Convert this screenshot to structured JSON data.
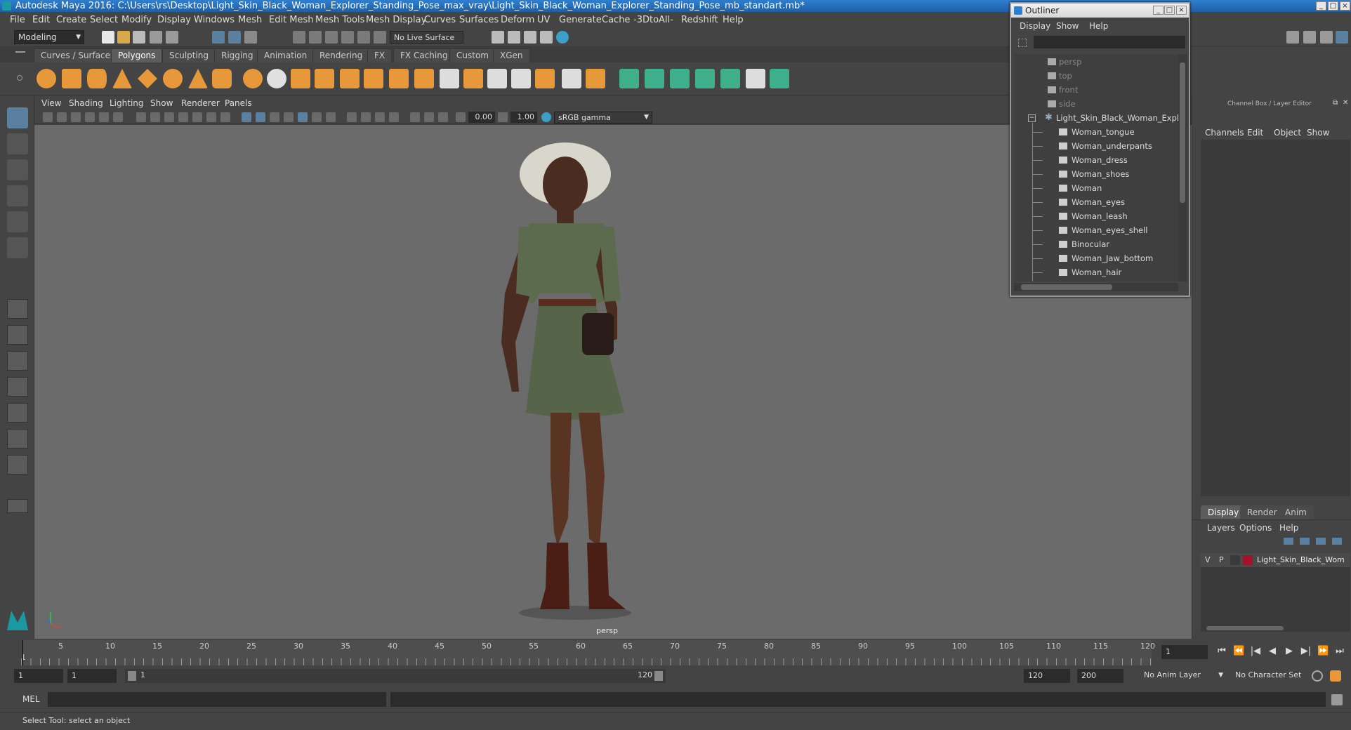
{
  "window": {
    "title": "Autodesk Maya 2016: C:\\Users\\rs\\Desktop\\Light_Skin_Black_Woman_Explorer_Standing_Pose_max_vray\\Light_Skin_Black_Woman_Explorer_Standing_Pose_mb_standart.mb*"
  },
  "menu": [
    "File",
    "Edit",
    "Create",
    "Select",
    "Modify",
    "Display",
    "Windows",
    "Mesh",
    "Edit Mesh",
    "Mesh Tools",
    "Mesh Display",
    "Curves",
    "Surfaces",
    "Deform",
    "UV",
    "Generate",
    "Cache",
    "-3DtoAll-",
    "Redshift",
    "Help"
  ],
  "status": {
    "mode": "Modeling",
    "live_surface": "No Live Surface"
  },
  "shelf_tabs": [
    "Curves / Surfaces",
    "Polygons",
    "Sculpting",
    "Rigging",
    "Animation",
    "Rendering",
    "FX",
    "FX Caching",
    "Custom",
    "XGen"
  ],
  "shelf_active": "Polygons",
  "panel_menu": [
    "View",
    "Shading",
    "Lighting",
    "Show",
    "Renderer",
    "Panels"
  ],
  "panel_tools": {
    "exposure": "0.00",
    "gamma": "1.00",
    "color_space": "sRGB gamma"
  },
  "viewport": {
    "camera_label": "persp"
  },
  "outliner": {
    "title": "Outliner",
    "menu": [
      "Display",
      "Show",
      "Help"
    ],
    "cameras": [
      "persp",
      "top",
      "front",
      "side"
    ],
    "group": "Light_Skin_Black_Woman_Explorer",
    "children": [
      "Woman_tongue",
      "Woman_underpants",
      "Woman_dress",
      "Woman_shoes",
      "Woman",
      "Woman_eyes",
      "Woman_leash",
      "Woman_eyes_shell",
      "Binocular",
      "Woman_Jaw_bottom",
      "Woman_hair"
    ]
  },
  "channel_box": {
    "title": "Channel Box / Layer Editor",
    "menu": [
      "Channels",
      "Edit",
      "Object",
      "Show"
    ],
    "tabs": [
      "Display",
      "Render",
      "Anim"
    ],
    "layer_menu": [
      "Layers",
      "Options",
      "Help"
    ],
    "layer": {
      "v": "V",
      "p": "P",
      "name": "Light_Skin_Black_Wom",
      "color": "#a0142a"
    }
  },
  "timeline": {
    "ticks": [
      "5",
      "10",
      "15",
      "20",
      "25",
      "30",
      "35",
      "40",
      "45",
      "50",
      "55",
      "60",
      "65",
      "70",
      "75",
      "80",
      "85",
      "90",
      "95",
      "100",
      "105",
      "110",
      "115",
      "120"
    ],
    "current_frame_label": "1",
    "current_frame": "1"
  },
  "range": {
    "start": "1",
    "start_inner": "1",
    "slider_start": "1",
    "slider_end": "120",
    "end_inner": "120",
    "end": "200",
    "anim_layer": "No Anim Layer",
    "character_set": "No Character Set"
  },
  "command": {
    "language": "MEL"
  },
  "help": {
    "text": "Select Tool: select an object"
  },
  "colors": {
    "accent": "#5b7f9e",
    "title_bar": "#2e7fd0",
    "shelf_cube": "#e6983a",
    "shelf_green": "#3fae8a"
  }
}
